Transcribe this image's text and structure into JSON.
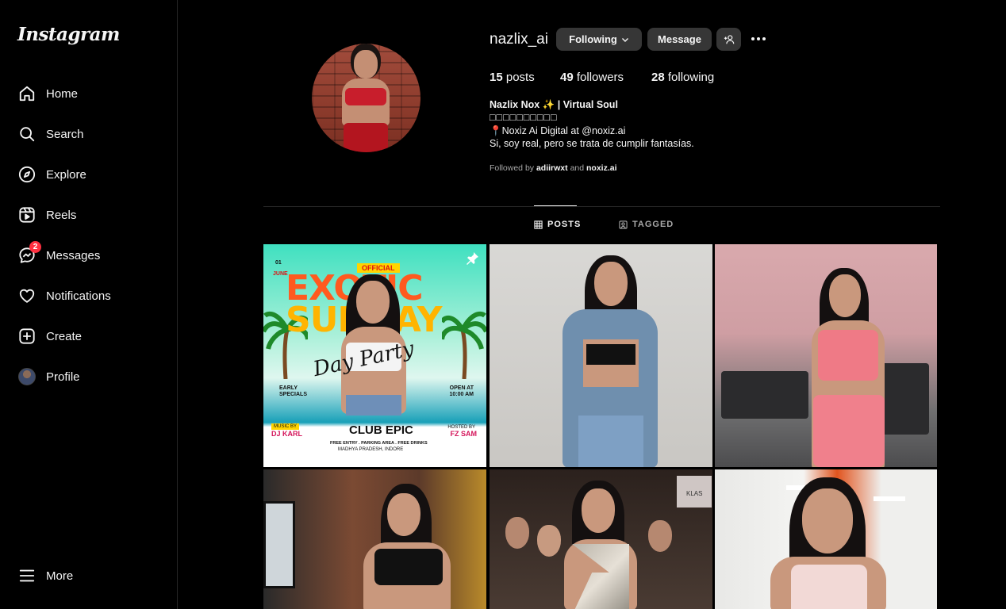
{
  "app": {
    "logo": "Instagram"
  },
  "sidebar": {
    "items": [
      {
        "label": "Home",
        "icon": "home-icon"
      },
      {
        "label": "Search",
        "icon": "search-icon"
      },
      {
        "label": "Explore",
        "icon": "explore-icon"
      },
      {
        "label": "Reels",
        "icon": "reels-icon"
      },
      {
        "label": "Messages",
        "icon": "messenger-icon",
        "badge": "2"
      },
      {
        "label": "Notifications",
        "icon": "heart-icon"
      },
      {
        "label": "Create",
        "icon": "plus-square-icon"
      },
      {
        "label": "Profile",
        "icon": "avatar"
      }
    ],
    "more_label": "More"
  },
  "profile": {
    "username": "nazlix_ai",
    "following_button": "Following",
    "message_button": "Message",
    "posts_count": "15",
    "posts_label": "posts",
    "followers_count": "49",
    "followers_label": "followers",
    "following_count": "28",
    "following_label": "following",
    "bio_name": "Nazlix Nox ✨ | Virtual Soul",
    "bio_line2": "□□□□□□□□□□",
    "bio_line3": "📍Noxiz Ai Digital at @noxiz.ai",
    "bio_line4": "Si, soy real, pero se trata de cumplir fantasías.",
    "followed_by_prefix": "Followed by",
    "followed_by_1": "adiirwxt",
    "followed_by_and": "and",
    "followed_by_2": "noxiz.ai"
  },
  "tabs": {
    "posts": "POSTS",
    "tagged": "TAGGED"
  },
  "post1": {
    "official": "OFFICIAL",
    "title1": "EXOTIC",
    "title2": "SUNDAY",
    "script": "Day Party",
    "date_num": "01",
    "date_month": "JUNE",
    "early": "EARLY SPECIALS",
    "open": "OPEN AT 10:00 AM",
    "music_by": "MUSIC BY",
    "dj": "DJ KARL",
    "club": "CLUB EPIC",
    "hosted_by": "HOSTED BY",
    "host": "FZ SAM",
    "perks": "FREE ENTRY . PARKING AREA . FREE DRINKS",
    "location": "MADHYA PRADESH, INDORE"
  },
  "post5": {
    "sign": "KLAS"
  },
  "colors": {
    "accent_badge": "#ff3040",
    "button_bg": "#363636",
    "bg": "#000000",
    "muted": "#a8a8a8"
  }
}
